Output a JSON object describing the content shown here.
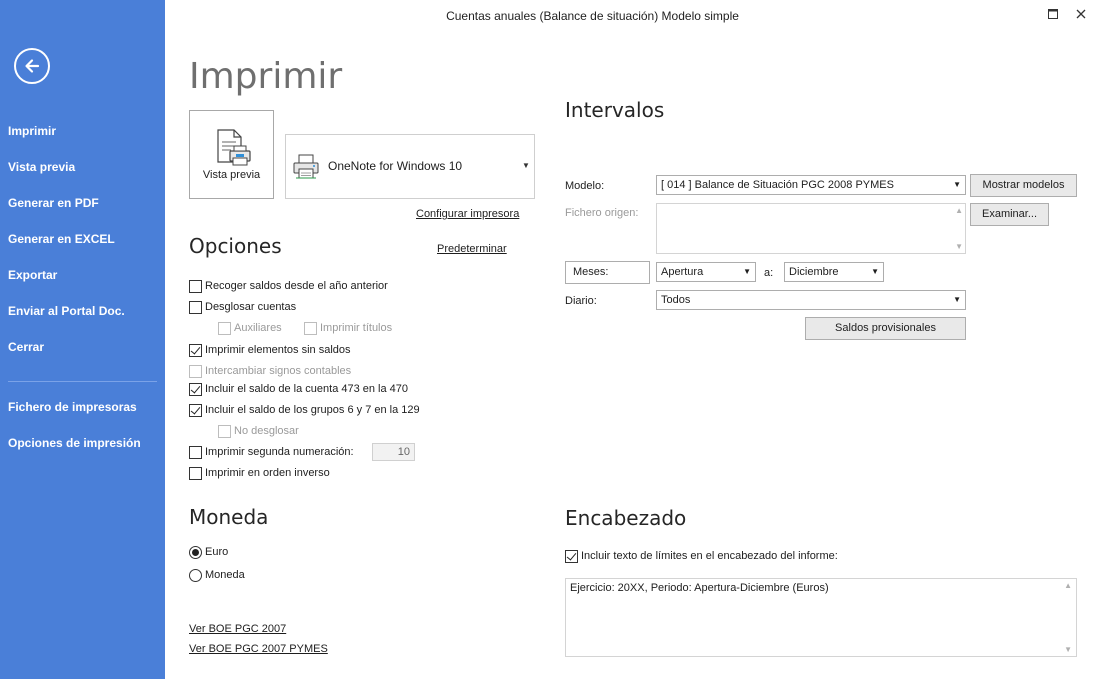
{
  "window": {
    "title": "Cuentas anuales (Balance de situación) Modelo simple"
  },
  "sidebar": {
    "items": [
      {
        "label": "Imprimir"
      },
      {
        "label": "Vista previa"
      },
      {
        "label": "Generar en PDF"
      },
      {
        "label": "Generar en EXCEL"
      },
      {
        "label": "Exportar"
      },
      {
        "label": "Enviar al Portal Doc."
      },
      {
        "label": "Cerrar"
      }
    ],
    "secondary": [
      {
        "label": "Fichero de impresoras"
      },
      {
        "label": "Opciones de impresión"
      }
    ]
  },
  "main": {
    "title": "Imprimir",
    "preview_label": "Vista previa",
    "printer": "OneNote for Windows 10",
    "configure_printer": "Configurar impresora",
    "options_title": "Opciones",
    "default_link": "Predeterminar",
    "options": [
      {
        "label": "Recoger saldos desde el año anterior",
        "checked": false,
        "disabled": false
      },
      {
        "label": "Desglosar cuentas",
        "checked": false,
        "disabled": false
      },
      {
        "label": "Auxiliares",
        "checked": false,
        "disabled": true
      },
      {
        "label": "Imprimir títulos",
        "checked": false,
        "disabled": true
      },
      {
        "label": "Imprimir elementos sin saldos",
        "checked": true,
        "disabled": false
      },
      {
        "label": "Intercambiar signos contables",
        "checked": false,
        "disabled": true
      },
      {
        "label": "Incluir el saldo de la cuenta 473 en la 470",
        "checked": true,
        "disabled": false
      },
      {
        "label": "Incluir el saldo de los grupos 6 y 7 en la 129",
        "checked": true,
        "disabled": false
      },
      {
        "label": "No desglosar",
        "checked": false,
        "disabled": true
      },
      {
        "label": "Imprimir segunda numeración:",
        "checked": false,
        "disabled": false
      },
      {
        "label": "Imprimir en orden inverso",
        "checked": false,
        "disabled": false
      }
    ],
    "second_numbering_value": "10",
    "currency_title": "Moneda",
    "currency_options": [
      {
        "label": "Euro",
        "selected": true
      },
      {
        "label": "Moneda",
        "selected": false
      }
    ],
    "links": [
      "Ver BOE PGC 2007",
      "Ver BOE PGC 2007 PYMES"
    ]
  },
  "intervals": {
    "title": "Intervalos",
    "model_label": "Modelo:",
    "model_value": "[ 014 ] Balance de Situación PGC 2008 PYMES",
    "show_models_button": "Mostrar modelos",
    "source_file_label": "Fichero origen:",
    "browse_button": "Examinar...",
    "months_button": "Meses:",
    "from_value": "Apertura",
    "to_label": "a:",
    "to_value": "Diciembre",
    "journal_label": "Diario:",
    "journal_value": "Todos",
    "provisional_button": "Saldos provisionales"
  },
  "header_section": {
    "title": "Encabezado",
    "include_limits_label": "Incluir texto de límites en el encabezado del informe:",
    "include_limits_checked": true,
    "header_text": "Ejercicio: 20XX, Periodo: Apertura-Diciembre (Euros)"
  }
}
